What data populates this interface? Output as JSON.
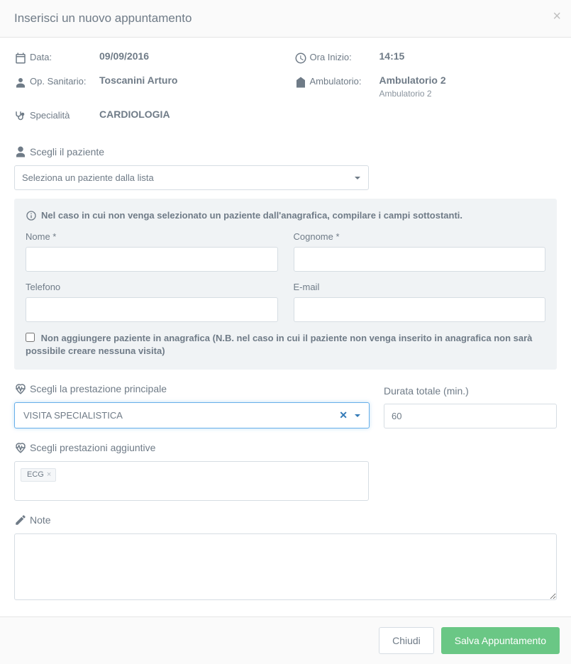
{
  "header": {
    "title": "Inserisci un nuovo appuntamento",
    "close": "×"
  },
  "info": {
    "date_label": "Data:",
    "date_value": "09/09/2016",
    "time_label": "Ora Inizio:",
    "time_value": "14:15",
    "operator_label": "Op. Sanitario:",
    "operator_value": "Toscanini Arturo",
    "clinic_label": "Ambulatorio:",
    "clinic_value": "Ambulatorio 2",
    "clinic_sub": "Ambulatorio 2",
    "specialty_label": "Specialità",
    "specialty_value": "CARDIOLOGIA"
  },
  "patient": {
    "section_title": "Scegli il paziente",
    "select_placeholder": "Seleziona un paziente dalla lista",
    "panel_notice": "Nel caso in cui non venga selezionato un paziente dall'anagrafica, compilare i campi sottostanti.",
    "name_label": "Nome *",
    "surname_label": "Cognome *",
    "phone_label": "Telefono",
    "email_label": "E-mail",
    "no_add_label": "Non aggiungere paziente in anagrafica (N.B. nel caso in cui il paziente non venga inserito in anagrafica non sarà possibile creare nessuna visita)"
  },
  "service": {
    "main_title": "Scegli la prestazione principale",
    "main_value": "VISITA SPECIALISTICA",
    "duration_label": "Durata totale (min.)",
    "duration_value": "60",
    "additional_title": "Scegli prestazioni aggiuntive",
    "tags": [
      "ECG"
    ]
  },
  "notes": {
    "title": "Note"
  },
  "footer": {
    "close": "Chiudi",
    "save": "Salva Appuntamento"
  }
}
